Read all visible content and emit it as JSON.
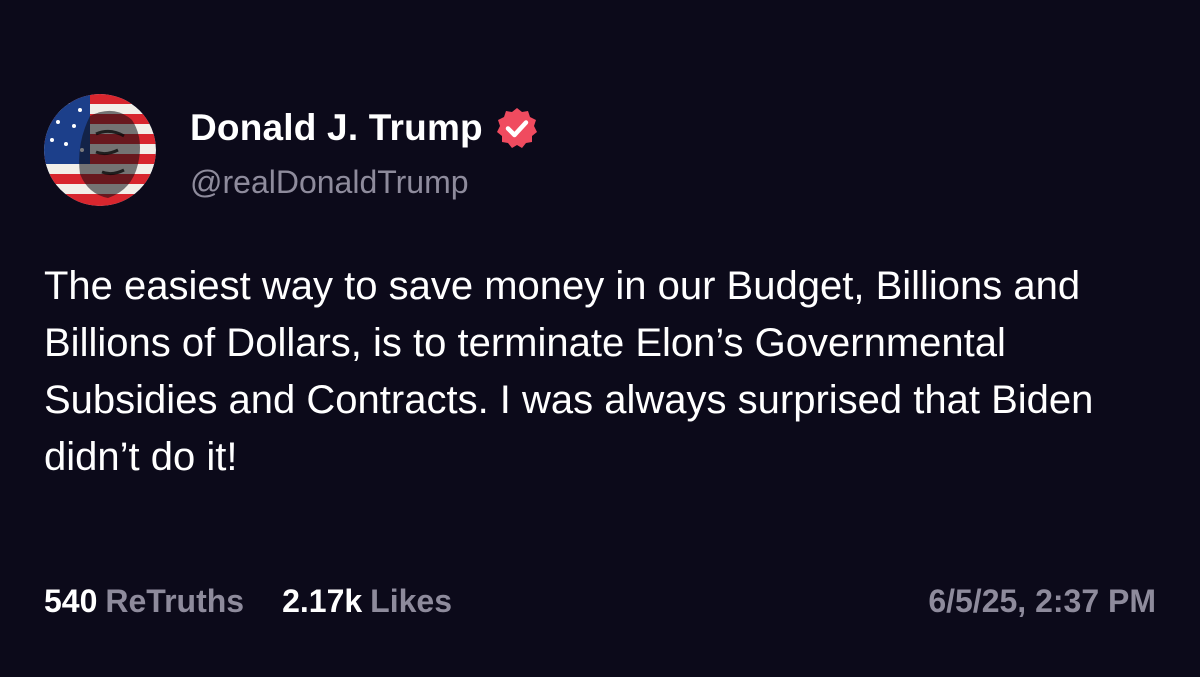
{
  "post": {
    "author": {
      "display_name": "Donald J. Trump",
      "handle": "@realDonaldTrump",
      "avatar": "profile-photo-avatar",
      "verified_icon": "verified-badge-icon"
    },
    "text": "The easiest way to save money in our Budget, Billions and Billions of Dollars, is to terminate Elon’s Governmental Subsidies and Contracts. I was always surprised that Biden didn’t do it!",
    "stats": {
      "retruths_count": "540",
      "retruths_label": "ReTruths",
      "likes_count": "2.17k",
      "likes_label": "Likes"
    },
    "timestamp": "6/5/25, 2:37 PM"
  },
  "colors": {
    "background": "#0c0a1a",
    "text_primary": "#ffffff",
    "text_secondary": "#8e8b9c",
    "verified_badge": "#f04b5f"
  }
}
